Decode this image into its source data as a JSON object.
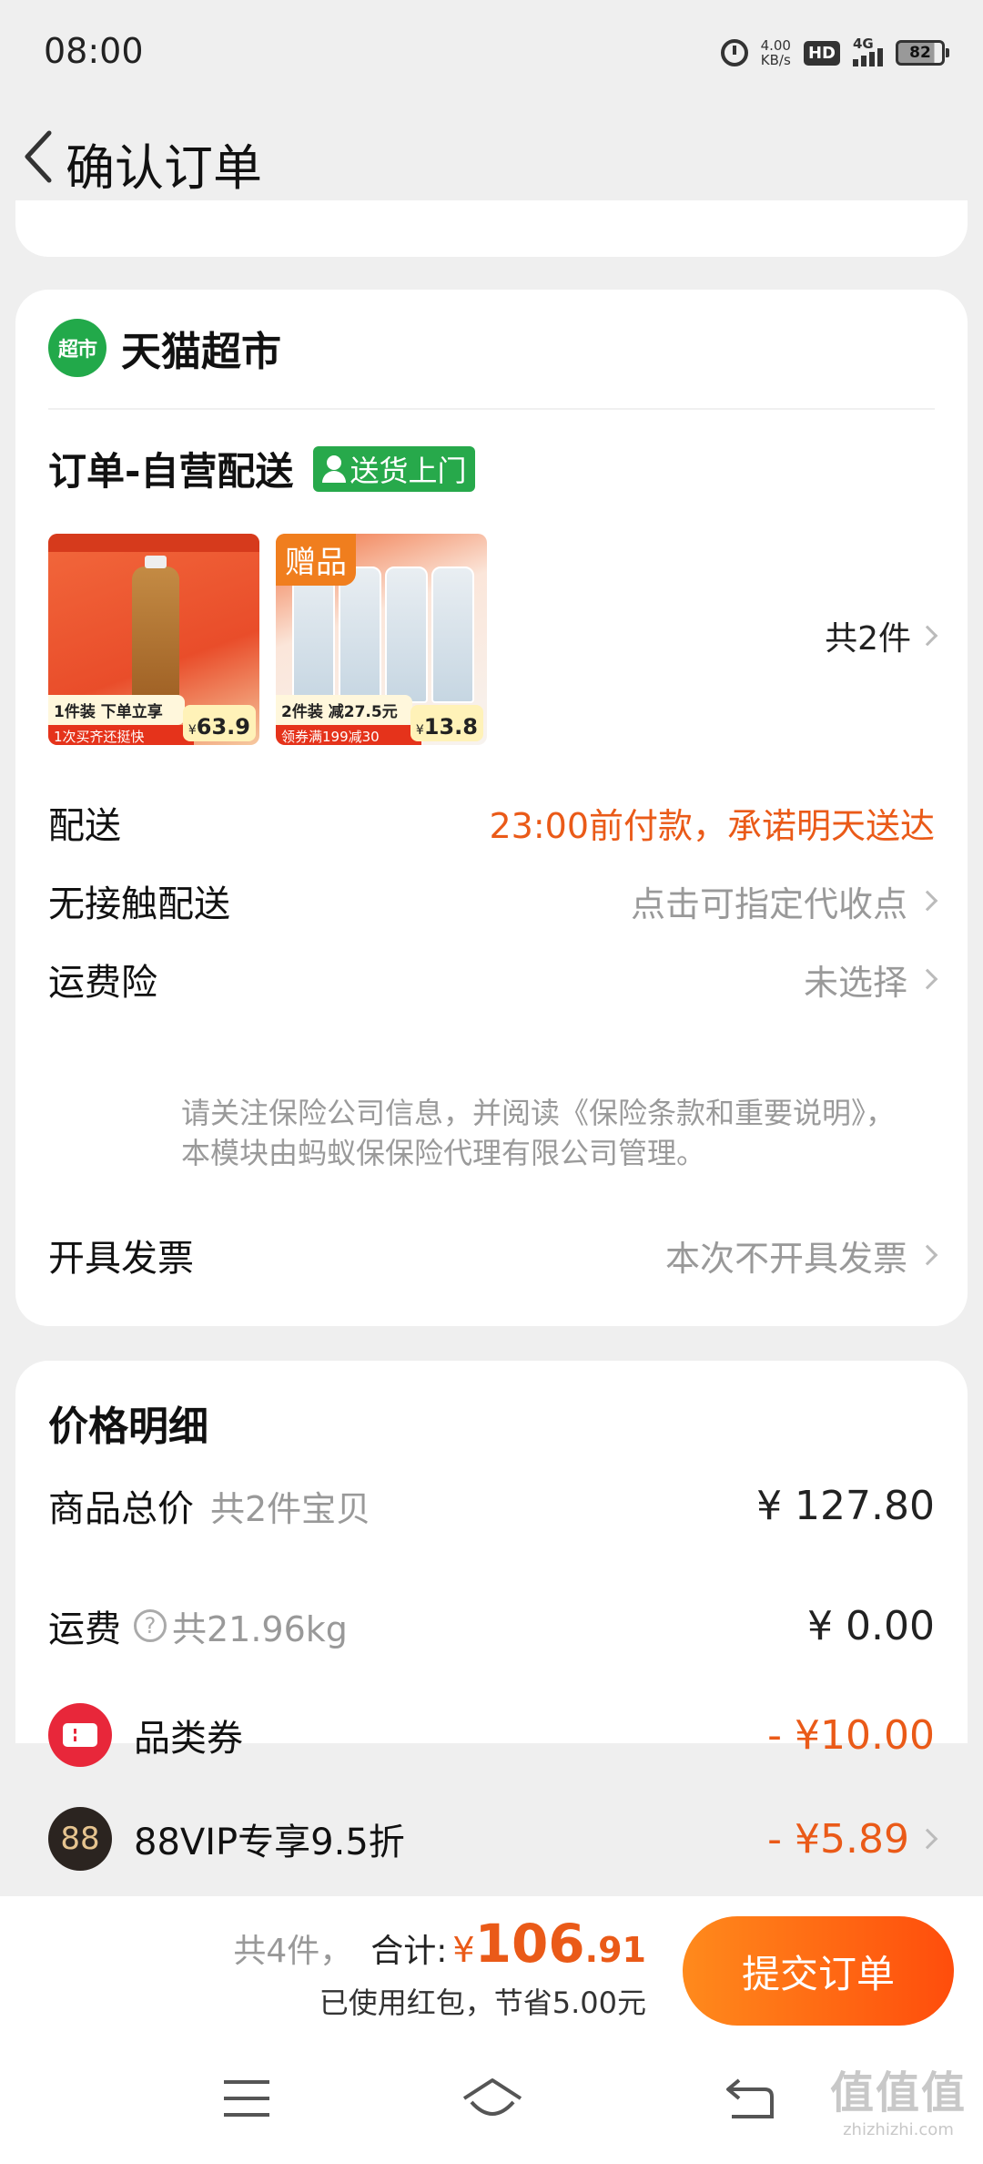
{
  "status_bar": {
    "time": "08:00",
    "net_speed_value": "4.00",
    "net_speed_unit": "KB/s",
    "hd_label": "HD",
    "network_label": "4G",
    "battery_level": "82"
  },
  "header": {
    "title": "确认订单"
  },
  "shop": {
    "logo_text": "超市",
    "name": "天猫超市"
  },
  "order": {
    "delivery_title": "订单-自营配送",
    "delivery_tag": "送货上门",
    "item_count": "共2件",
    "products": [
      {
        "promo": "1件装 下单立享",
        "coupon": "1次买齐还挺快",
        "price_currency": "¥",
        "price": "63.9"
      },
      {
        "badge": "赠品",
        "promo": "2件装 减27.5元",
        "coupon": "领券满199减30",
        "price_currency": "¥",
        "price": "13.8"
      }
    ]
  },
  "rows": {
    "delivery": {
      "label": "配送",
      "value": "23:00前付款，承诺明天送达"
    },
    "contactless": {
      "label": "无接触配送",
      "value": "点击可指定代收点"
    },
    "shipping_insurance": {
      "label": "运费险",
      "value": "未选择",
      "note": "请关注保险公司信息，并阅读《保险条款和重要说明》，本模块由蚂蚁保保险代理有限公司管理。"
    },
    "invoice": {
      "label": "开具发票",
      "value": "本次不开具发票"
    }
  },
  "price_detail": {
    "title": "价格明细",
    "goods_total_label": "商品总价",
    "goods_total_sub": "共2件宝贝",
    "goods_total_value": "¥ 127.80",
    "shipping_label": "运费",
    "shipping_help": "?",
    "shipping_weight": "共21.96kg",
    "shipping_value": "¥ 0.00",
    "category_coupon_label": "品类券",
    "category_coupon_value": "- ¥10.00",
    "vip_icon_text": "88",
    "vip_label": "88VIP专享9.5折",
    "vip_value": "- ¥5.89"
  },
  "footer": {
    "count": "共4件，",
    "total_label": "合计:",
    "currency": "¥",
    "total_int": "106",
    "total_dec": ".91",
    "savings": "已使用红包，节省5.00元",
    "submit_label": "提交订单"
  },
  "watermark": {
    "mark": "值值值",
    "url": "zhizhizhi.com"
  },
  "colors": {
    "accent_orange": "#ea5a18",
    "shop_green": "#22a94a",
    "coupon_red": "#e8273a",
    "submit_gradient_start": "#ff8a1c",
    "submit_gradient_end": "#ff4d0c"
  }
}
